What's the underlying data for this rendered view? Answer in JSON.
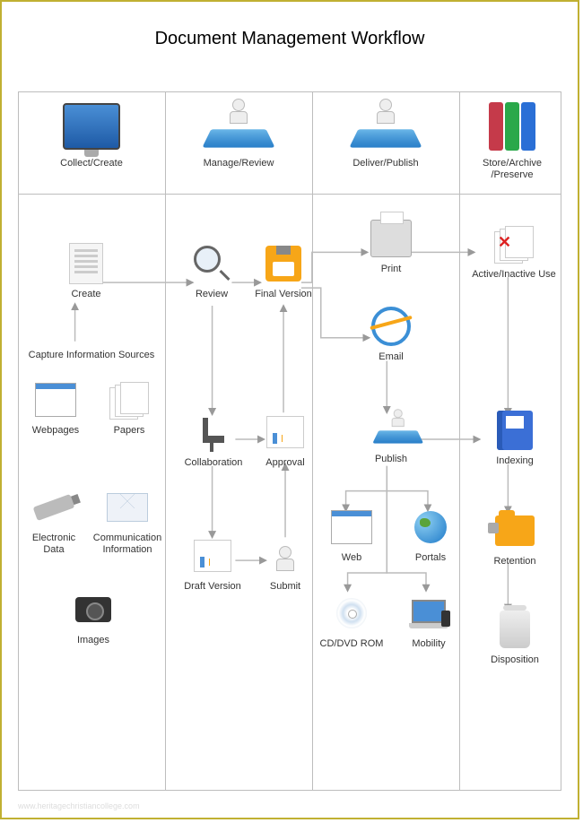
{
  "title": "Document Management Workflow",
  "columns": {
    "collect": "Collect/Create",
    "manage": "Manage/Review",
    "deliver": "Deliver/Publish",
    "store": "Store/Archive\n/Preserve"
  },
  "nodes": {
    "create": "Create",
    "capture": "Capture Information Sources",
    "webpages": "Webpages",
    "papers": "Papers",
    "edata": "Electronic\nData",
    "comm": "Communication\nInformation",
    "images": "Images",
    "review": "Review",
    "final": "Final Version",
    "collab": "Collaboration",
    "approval": "Approval",
    "draft": "Draft Version",
    "submit": "Submit",
    "print": "Print",
    "email": "Email",
    "publish": "Publish",
    "web": "Web",
    "portals": "Portals",
    "cddvd": "CD/DVD ROM",
    "mobility": "Mobility",
    "active": "Active/Inactive Use",
    "indexing": "Indexing",
    "retention": "Retention",
    "disposition": "Disposition"
  },
  "binderColors": [
    "#c53a4a",
    "#2aa84a",
    "#2a6fd6"
  ],
  "watermark": "www.heritagechristiancollege.com"
}
